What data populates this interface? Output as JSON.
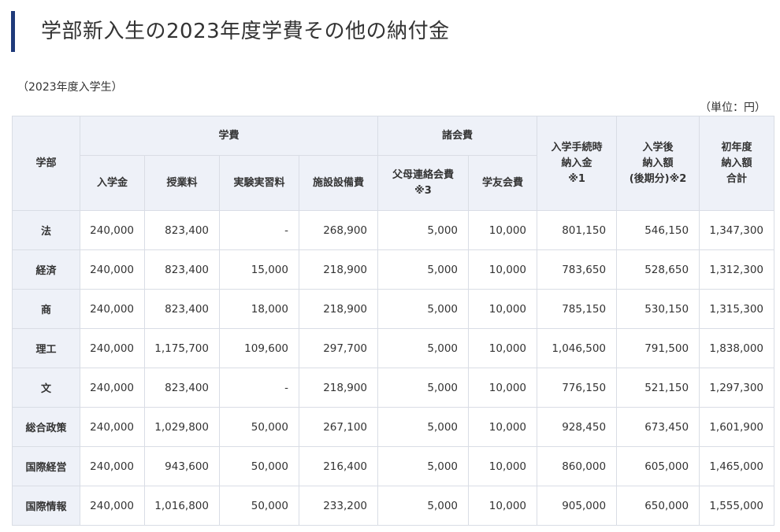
{
  "page": {
    "title": "学部新入生の2023年度学費その他の納付金",
    "subheading": "（2023年度入学生）",
    "unit": "（単位：円）"
  },
  "table": {
    "header": {
      "department": "学部",
      "tuition_group": "学費",
      "fees_group": "諸会費",
      "admission_payment": "入学手続時\n納入金\n※1",
      "post_admission": "入学後\n納入額\n(後期分)※2",
      "first_year_total": "初年度\n納入額\n合計",
      "entrance_fee": "入学金",
      "tuition": "授業料",
      "lab_fee": "実験実習料",
      "facility_fee": "施設設備費",
      "parent_fee": "父母連絡会費\n※3",
      "alumni_fee": "学友会費"
    },
    "rows": [
      {
        "dept": "法",
        "entrance": "240,000",
        "tuition": "823,400",
        "lab": "-",
        "facility": "268,900",
        "parent": "5,000",
        "alumni": "10,000",
        "admission": "801,150",
        "post": "546,150",
        "total": "1,347,300"
      },
      {
        "dept": "経済",
        "entrance": "240,000",
        "tuition": "823,400",
        "lab": "15,000",
        "facility": "218,900",
        "parent": "5,000",
        "alumni": "10,000",
        "admission": "783,650",
        "post": "528,650",
        "total": "1,312,300"
      },
      {
        "dept": "商",
        "entrance": "240,000",
        "tuition": "823,400",
        "lab": "18,000",
        "facility": "218,900",
        "parent": "5,000",
        "alumni": "10,000",
        "admission": "785,150",
        "post": "530,150",
        "total": "1,315,300"
      },
      {
        "dept": "理工",
        "entrance": "240,000",
        "tuition": "1,175,700",
        "lab": "109,600",
        "facility": "297,700",
        "parent": "5,000",
        "alumni": "10,000",
        "admission": "1,046,500",
        "post": "791,500",
        "total": "1,838,000"
      },
      {
        "dept": "文",
        "entrance": "240,000",
        "tuition": "823,400",
        "lab": "-",
        "facility": "218,900",
        "parent": "5,000",
        "alumni": "10,000",
        "admission": "776,150",
        "post": "521,150",
        "total": "1,297,300"
      },
      {
        "dept": "総合政策",
        "entrance": "240,000",
        "tuition": "1,029,800",
        "lab": "50,000",
        "facility": "267,100",
        "parent": "5,000",
        "alumni": "10,000",
        "admission": "928,450",
        "post": "673,450",
        "total": "1,601,900"
      },
      {
        "dept": "国際経営",
        "entrance": "240,000",
        "tuition": "943,600",
        "lab": "50,000",
        "facility": "216,400",
        "parent": "5,000",
        "alumni": "10,000",
        "admission": "860,000",
        "post": "605,000",
        "total": "1,465,000"
      },
      {
        "dept": "国際情報",
        "entrance": "240,000",
        "tuition": "1,016,800",
        "lab": "50,000",
        "facility": "233,200",
        "parent": "5,000",
        "alumni": "10,000",
        "admission": "905,000",
        "post": "650,000",
        "total": "1,555,000"
      }
    ]
  },
  "colors": {
    "accent": "#1f3a7a",
    "header_bg": "#eef1f8",
    "border": "#d9dde5"
  }
}
